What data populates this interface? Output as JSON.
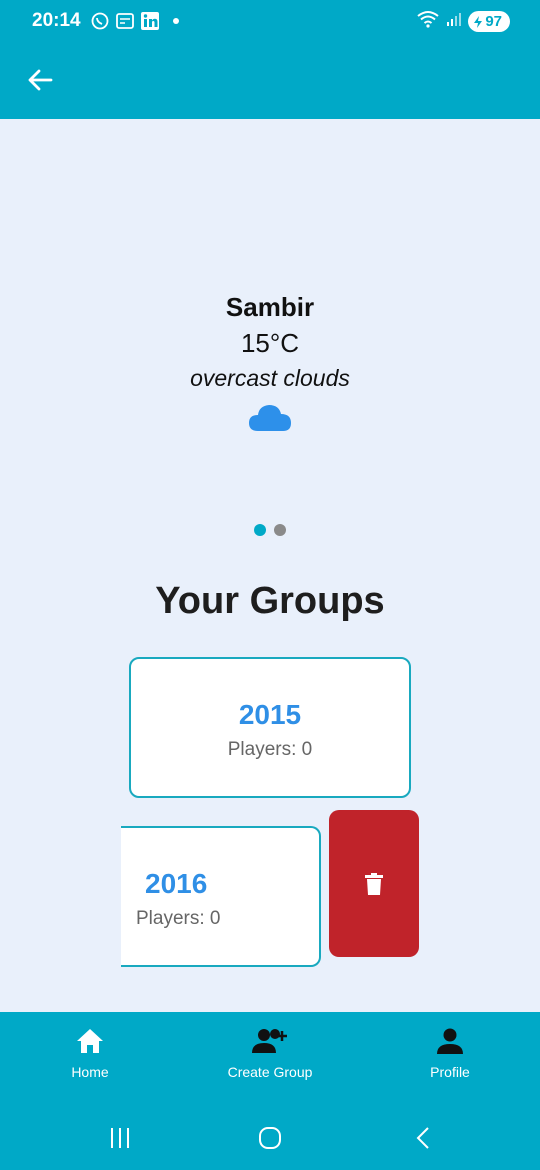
{
  "status_bar": {
    "time": "20:14",
    "battery": "97",
    "icons": [
      "viber-icon",
      "news-icon",
      "linkedin-icon",
      "notification-dot",
      "wifi-icon",
      "signal-icon",
      "battery-icon"
    ]
  },
  "app_bar": {
    "back_icon": "arrow-left-icon"
  },
  "weather": {
    "city": "Sambir",
    "temperature": "15°C",
    "description": "overcast clouds",
    "icon": "cloud-icon"
  },
  "pager": {
    "pages": 2,
    "active": 0
  },
  "groups": {
    "title": "Your Groups",
    "items": [
      {
        "year": "2015",
        "players": "Players: 0"
      },
      {
        "year": "2016",
        "players": "Players: 0"
      }
    ],
    "delete_icon": "trash-icon"
  },
  "bottom_nav": {
    "items": [
      {
        "label": "Home",
        "icon": "home-icon"
      },
      {
        "label": "Create Group",
        "icon": "add-user-icon"
      },
      {
        "label": "Profile",
        "icon": "person-icon"
      }
    ]
  },
  "colors": {
    "primary": "#00a9c7",
    "background": "#e9f0fb",
    "accent_blue": "#2f8fe6",
    "delete_red": "#c0232a",
    "pager_active": "#00a9c7",
    "pager_inactive": "#8a8a8a"
  }
}
